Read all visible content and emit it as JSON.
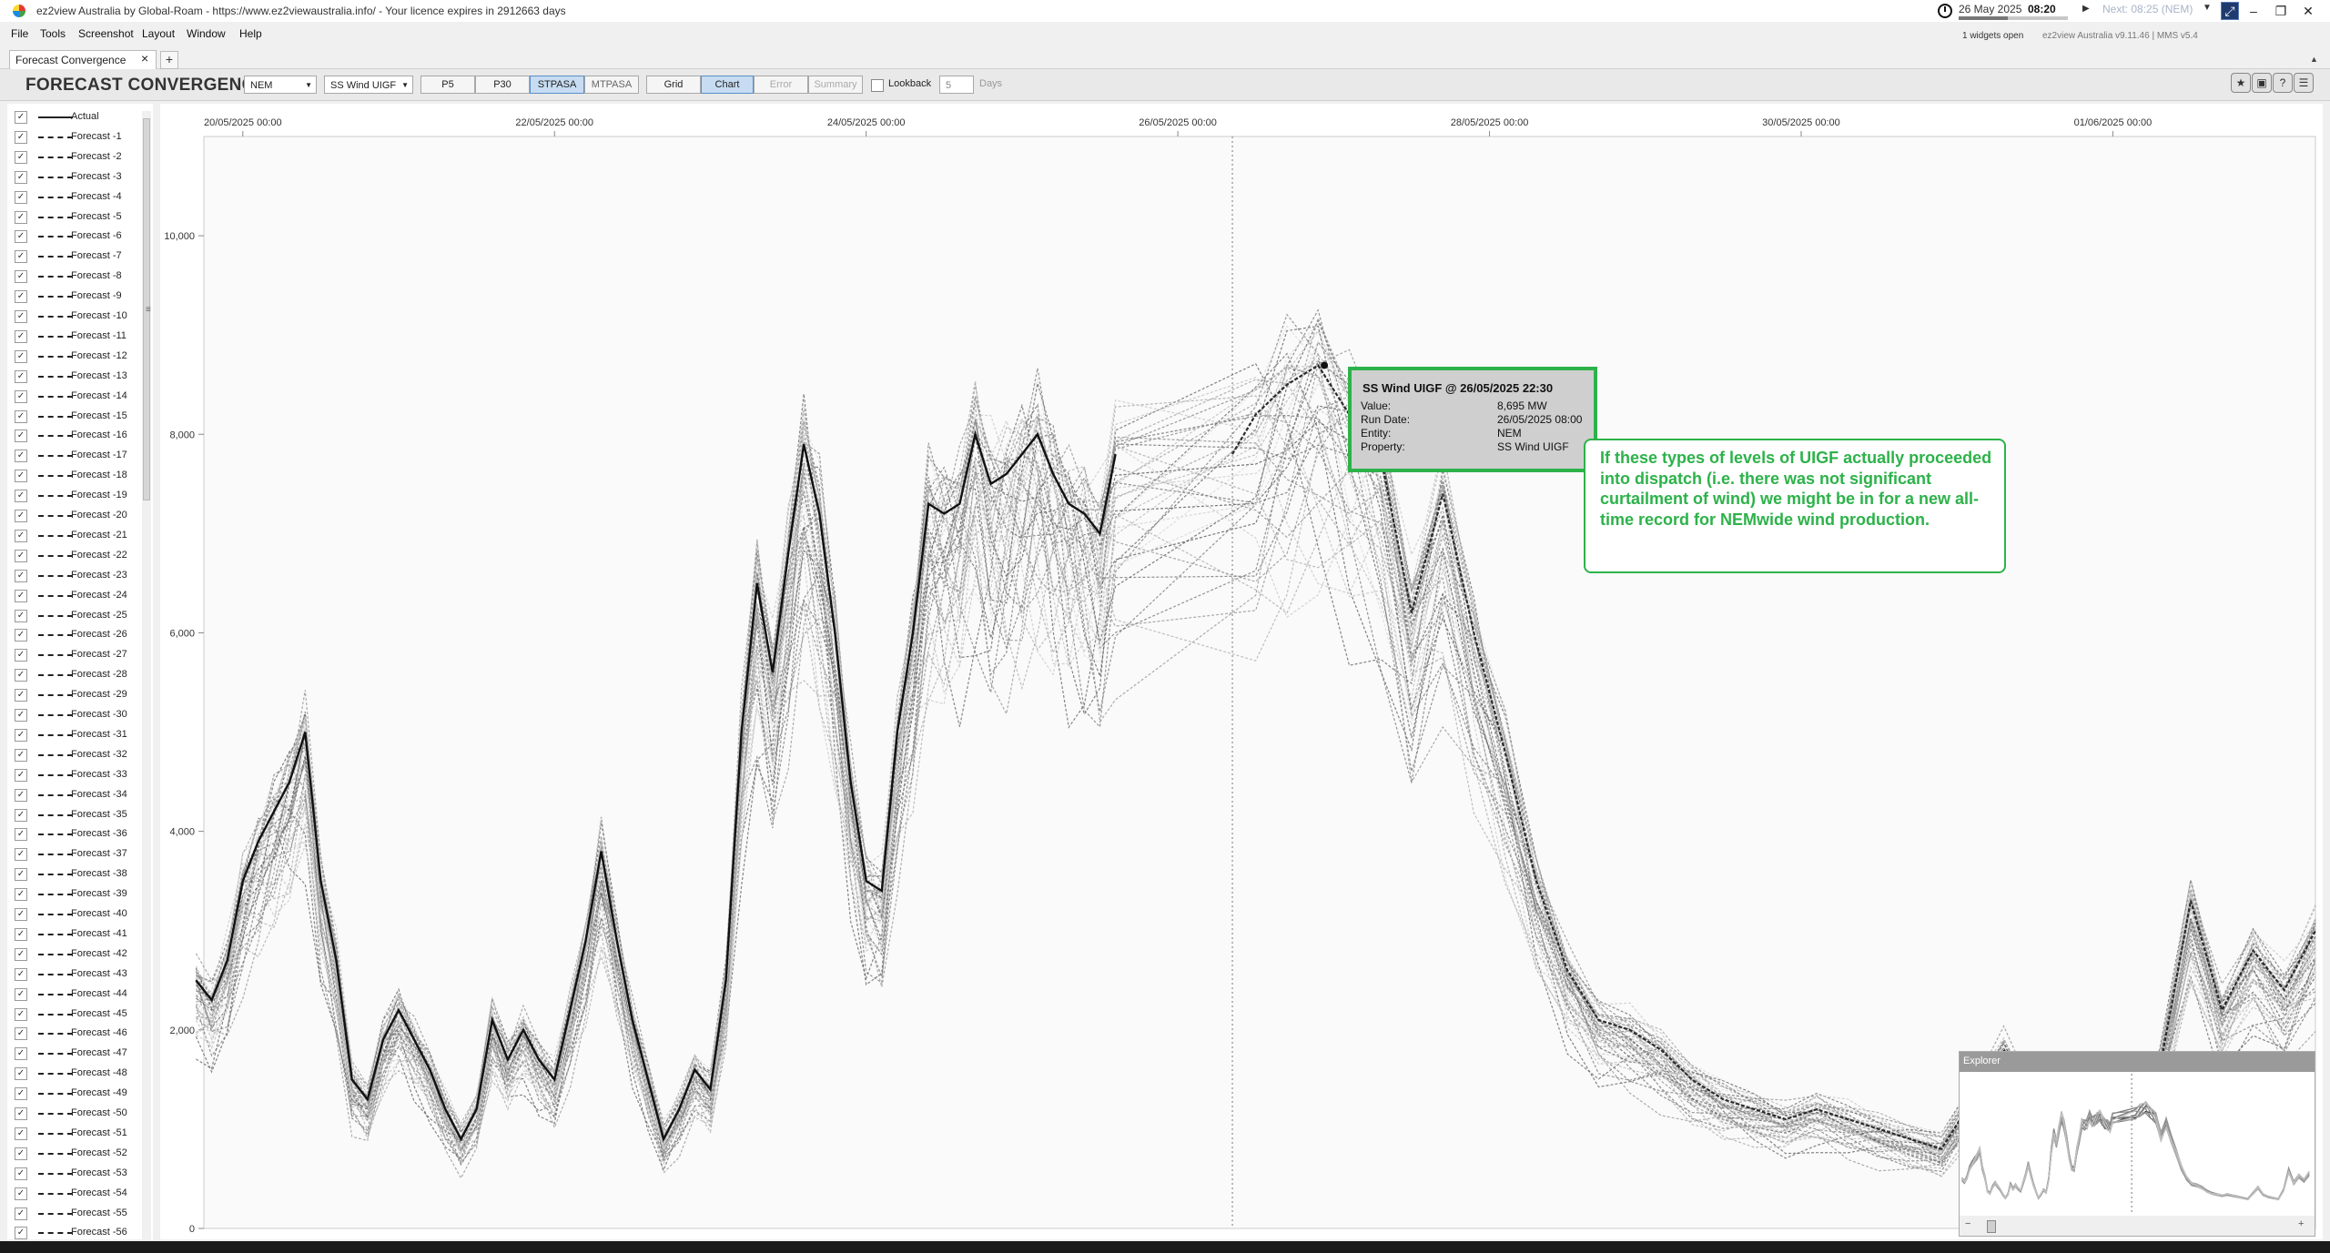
{
  "window": {
    "title": "ez2view Australia by Global-Roam - https://www.ez2viewaustralia.info/ - Your licence expires in 2912663 days",
    "date": "26 May 2025",
    "time": "08:20",
    "next": "Next: 08:25 (NEM)",
    "progress": 0.45,
    "widgets_open": "1 widgets open",
    "version": "ez2view Australia v9.11.46 | MMS v5.4"
  },
  "menu": [
    "File",
    "Tools",
    "Screenshot",
    "Layout",
    "Window",
    "Help"
  ],
  "tab": {
    "label": "Forecast Convergence",
    "close": "×",
    "add": "+"
  },
  "widget": {
    "title": "FORECAST CONVERGENCE",
    "region": "NEM",
    "measure": "SS Wind UIGF",
    "pasa_buttons": [
      "P5",
      "P30",
      "STPASA",
      "MTPASA"
    ],
    "pasa_active": "STPASA",
    "view_buttons": [
      "Grid",
      "Chart",
      "Error",
      "Summary"
    ],
    "view_active": "Chart",
    "lookback_label": "Lookback",
    "lookback_value": "5",
    "days_label": "Days"
  },
  "legend": {
    "items": [
      "Actual",
      "Forecast -1",
      "Forecast -2",
      "Forecast -3",
      "Forecast -4",
      "Forecast -5",
      "Forecast -6",
      "Forecast -7",
      "Forecast -8",
      "Forecast -9",
      "Forecast -10",
      "Forecast -11",
      "Forecast -12",
      "Forecast -13",
      "Forecast -14",
      "Forecast -15",
      "Forecast -16",
      "Forecast -17",
      "Forecast -18",
      "Forecast -19",
      "Forecast -20",
      "Forecast -21",
      "Forecast -22",
      "Forecast -23",
      "Forecast -24",
      "Forecast -25",
      "Forecast -26",
      "Forecast -27",
      "Forecast -28",
      "Forecast -29",
      "Forecast -30",
      "Forecast -31",
      "Forecast -32",
      "Forecast -33",
      "Forecast -34",
      "Forecast -35",
      "Forecast -36",
      "Forecast -37",
      "Forecast -38",
      "Forecast -39",
      "Forecast -40",
      "Forecast -41",
      "Forecast -42",
      "Forecast -43",
      "Forecast -44",
      "Forecast -45",
      "Forecast -46",
      "Forecast -47",
      "Forecast -48",
      "Forecast -49",
      "Forecast -50",
      "Forecast -51",
      "Forecast -52",
      "Forecast -53",
      "Forecast -54",
      "Forecast -55",
      "Forecast -56"
    ],
    "check": "✓"
  },
  "chart_data": {
    "type": "line",
    "x_ticks": [
      "20/05/2025 00:00",
      "22/05/2025 00:00",
      "24/05/2025 00:00",
      "26/05/2025 00:00",
      "28/05/2025 00:00",
      "30/05/2025 00:00",
      "01/06/2025 00:00"
    ],
    "y_ticks": [
      "0",
      "2,000",
      "4,000",
      "6,000",
      "8,000",
      "10,000"
    ],
    "ylim": [
      0,
      11000
    ],
    "xlim_days": [
      19.75,
      33.3
    ],
    "now_marker_day": 26.35,
    "series": [
      {
        "name": "Actual",
        "x_days": [
          19.7,
          19.8,
          19.9,
          20.0,
          20.1,
          20.2,
          20.3,
          20.4,
          20.5,
          20.6,
          20.7,
          20.8,
          20.9,
          21.0,
          21.1,
          21.2,
          21.3,
          21.4,
          21.5,
          21.6,
          21.7,
          21.8,
          21.9,
          22.0,
          22.1,
          22.2,
          22.3,
          22.4,
          22.5,
          22.6,
          22.7,
          22.8,
          22.9,
          23.0,
          23.1,
          23.2,
          23.3,
          23.4,
          23.5,
          23.6,
          23.7,
          23.8,
          23.9,
          24.0,
          24.1,
          24.2,
          24.3,
          24.4,
          24.5,
          24.6,
          24.7,
          24.8,
          24.9,
          25.0,
          25.1,
          25.2,
          25.3,
          25.4,
          25.5,
          25.6,
          25.7,
          25.8,
          25.9,
          26.0,
          26.1,
          26.2,
          26.3,
          26.35
        ],
        "values": [
          2500,
          2300,
          2700,
          3500,
          3900,
          4200,
          4500,
          5000,
          3500,
          2700,
          1500,
          1300,
          1900,
          2200,
          1900,
          1600,
          1200,
          900,
          1200,
          2100,
          1700,
          2000,
          1700,
          1500,
          2200,
          2900,
          3800,
          2900,
          2100,
          1500,
          900,
          1200,
          1600,
          1400,
          2500,
          5000,
          6500,
          5600,
          6800,
          7900,
          7200,
          6000,
          4500,
          3500,
          3400,
          5000,
          6000,
          7300,
          7200,
          7300,
          8000,
          7500,
          7600,
          7800,
          8000,
          7600,
          7300,
          7200,
          7000,
          7800
        ]
      },
      {
        "name": "Forecast -1",
        "x_days": [
          26.35,
          26.5,
          26.7,
          26.9,
          27.1,
          27.3,
          27.5,
          27.7,
          27.9,
          28.1,
          28.3,
          28.5,
          28.7,
          28.9,
          29.1,
          29.3,
          29.5,
          29.7,
          29.9,
          30.1,
          30.3,
          30.5,
          30.7,
          30.9,
          31.1,
          31.3,
          31.5,
          31.7,
          31.9,
          32.1,
          32.3,
          32.5,
          32.7,
          32.9,
          33.1,
          33.3
        ],
        "values": [
          7800,
          8200,
          8500,
          8695,
          8200,
          7800,
          6200,
          7400,
          6000,
          4800,
          3500,
          2600,
          2100,
          2000,
          1800,
          1500,
          1300,
          1200,
          1100,
          1200,
          1100,
          1000,
          900,
          800,
          1300,
          1800,
          1200,
          1000,
          900,
          800,
          1600,
          3300,
          2200,
          2800,
          2400,
          3000
        ]
      }
    ]
  },
  "tooltip": {
    "title": "SS Wind UIGF @ 26/05/2025 22:30",
    "rows": [
      {
        "k": "Value:",
        "v": "8,695 MW"
      },
      {
        "k": "Run Date:",
        "v": "26/05/2025 08:00"
      },
      {
        "k": "Entity:",
        "v": "NEM"
      },
      {
        "k": "Property:",
        "v": "SS Wind UIGF"
      }
    ]
  },
  "annotation": "If these types of levels of UIGF actually proceeded into dispatch (i.e. there was not significant curtailment of wind) we might be in for a new all-time record for NEMwide wind production.",
  "explorer": {
    "title": "Explorer"
  },
  "colors": {
    "accent_green": "#2db24a",
    "active_button": "#c7dcf2",
    "series_dark": "#222222",
    "series_light": "#bbbbbb"
  }
}
